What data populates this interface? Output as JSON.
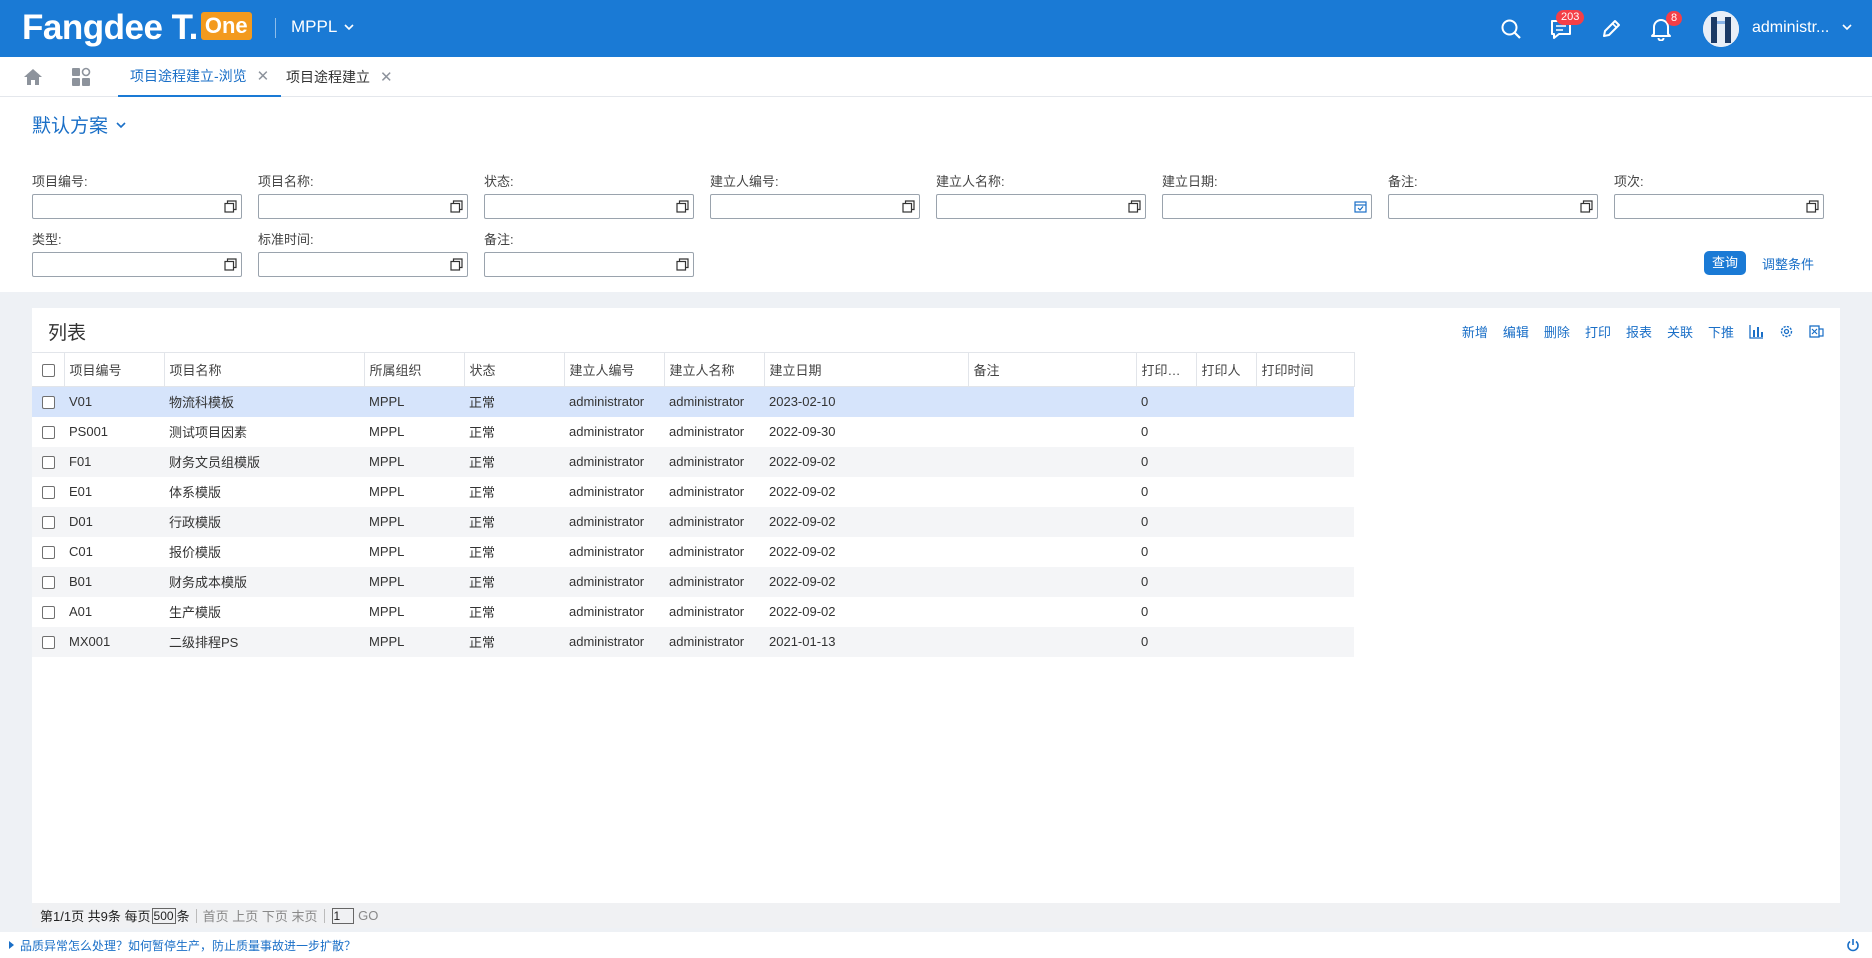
{
  "header": {
    "brand": "Fangdee T.",
    "brand_suffix": "One",
    "org": "MPPL",
    "message_badge": "203",
    "notification_badge": "8",
    "username": "administr..."
  },
  "tabs": [
    {
      "label": "项目途程建立-浏览",
      "active": true
    },
    {
      "label": "项目途程建立",
      "active": false
    }
  ],
  "filter": {
    "scheme": "默认方案",
    "fields": [
      {
        "label": "项目编号:"
      },
      {
        "label": "项目名称:"
      },
      {
        "label": "状态:"
      },
      {
        "label": "建立人编号:"
      },
      {
        "label": "建立人名称:"
      },
      {
        "label": "建立日期:"
      },
      {
        "label": "备注:"
      },
      {
        "label": "项次:"
      },
      {
        "label": "类型:"
      },
      {
        "label": "标准时间:"
      },
      {
        "label": "备注:"
      }
    ],
    "query_button": "查询",
    "adjust_button": "调整条件"
  },
  "list": {
    "title": "列表",
    "toolbar": [
      "新增",
      "编辑",
      "删除",
      "打印",
      "报表",
      "关联",
      "下推"
    ],
    "columns": [
      "项目编号",
      "项目名称",
      "所属组织",
      "状态",
      "建立人编号",
      "建立人名称",
      "建立日期",
      "备注",
      "打印…",
      "打印人",
      "打印时间"
    ],
    "rows": [
      [
        "V01",
        "物流科模板",
        "MPPL",
        "正常",
        "administrator",
        "administrator",
        "2023-02-10",
        "",
        "0",
        "",
        ""
      ],
      [
        "PS001",
        "测试项目因素",
        "MPPL",
        "正常",
        "administrator",
        "administrator",
        "2022-09-30",
        "",
        "0",
        "",
        ""
      ],
      [
        "F01",
        "财务文员组模版",
        "MPPL",
        "正常",
        "administrator",
        "administrator",
        "2022-09-02",
        "",
        "0",
        "",
        ""
      ],
      [
        "E01",
        "体系模版",
        "MPPL",
        "正常",
        "administrator",
        "administrator",
        "2022-09-02",
        "",
        "0",
        "",
        ""
      ],
      [
        "D01",
        "行政模版",
        "MPPL",
        "正常",
        "administrator",
        "administrator",
        "2022-09-02",
        "",
        "0",
        "",
        ""
      ],
      [
        "C01",
        "报价模版",
        "MPPL",
        "正常",
        "administrator",
        "administrator",
        "2022-09-02",
        "",
        "0",
        "",
        ""
      ],
      [
        "B01",
        "财务成本模版",
        "MPPL",
        "正常",
        "administrator",
        "administrator",
        "2022-09-02",
        "",
        "0",
        "",
        ""
      ],
      [
        "A01",
        "生产模版",
        "MPPL",
        "正常",
        "administrator",
        "administrator",
        "2022-09-02",
        "",
        "0",
        "",
        ""
      ],
      [
        "MX001",
        "二级排程PS",
        "MPPL",
        "正常",
        "administrator",
        "administrator",
        "2021-01-13",
        "",
        "0",
        "",
        ""
      ]
    ]
  },
  "pager": {
    "page_info": "第1/1页 共9条 每页",
    "page_size": "500",
    "unit": "条",
    "first": "首页",
    "prev": "上页",
    "next": "下页",
    "last": "末页",
    "page_input": "1",
    "go": "GO"
  },
  "footer": {
    "tip": "品质异常怎么处理？如何暂停生产，防止质量事故进一步扩散？"
  },
  "colors": {
    "primary": "#1a7ad5",
    "accent_orange": "#f39a1e",
    "badge_red": "#f43f47",
    "selected_row": "#d6e4fb"
  }
}
